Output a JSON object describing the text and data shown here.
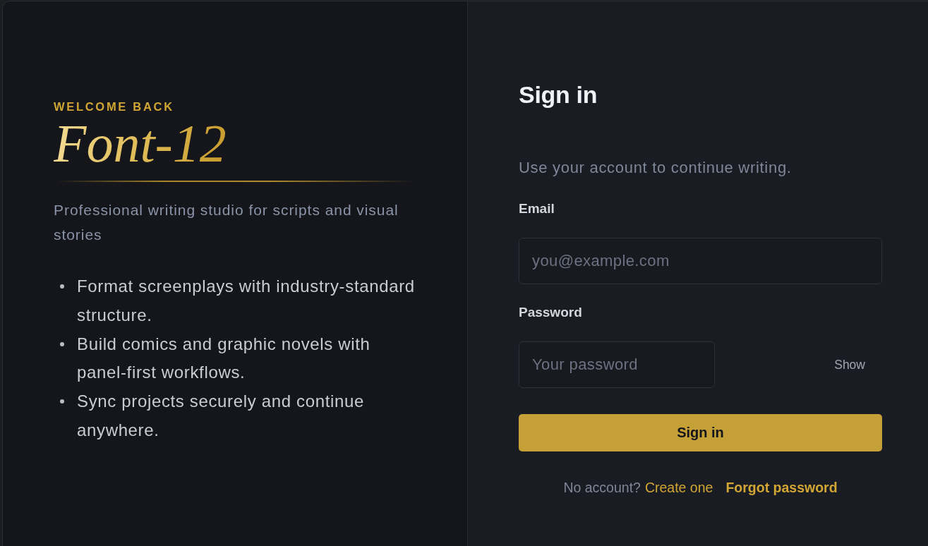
{
  "brand_panel": {
    "eyebrow": "WELCOME BACK",
    "logo": "Font-12",
    "tagline": "Professional writing studio for scripts and visual stories",
    "features": [
      "Format screenplays with industry-standard structure.",
      "Build comics and graphic novels with panel-first workflows.",
      "Sync projects securely and continue anywhere."
    ]
  },
  "sign_in_form": {
    "title": "Sign in",
    "subtitle": "Use your account to continue writing.",
    "fields": [
      {
        "kind": "email",
        "label": "Email",
        "placeholder": "you@example.com"
      },
      {
        "kind": "password",
        "label": "Password",
        "placeholder": "Your password",
        "toggle": "Show"
      }
    ],
    "submit": "Sign in",
    "footer": {
      "prompt": "No account?",
      "create_link": "Create one",
      "forgot_link": "Forgot password"
    }
  }
}
